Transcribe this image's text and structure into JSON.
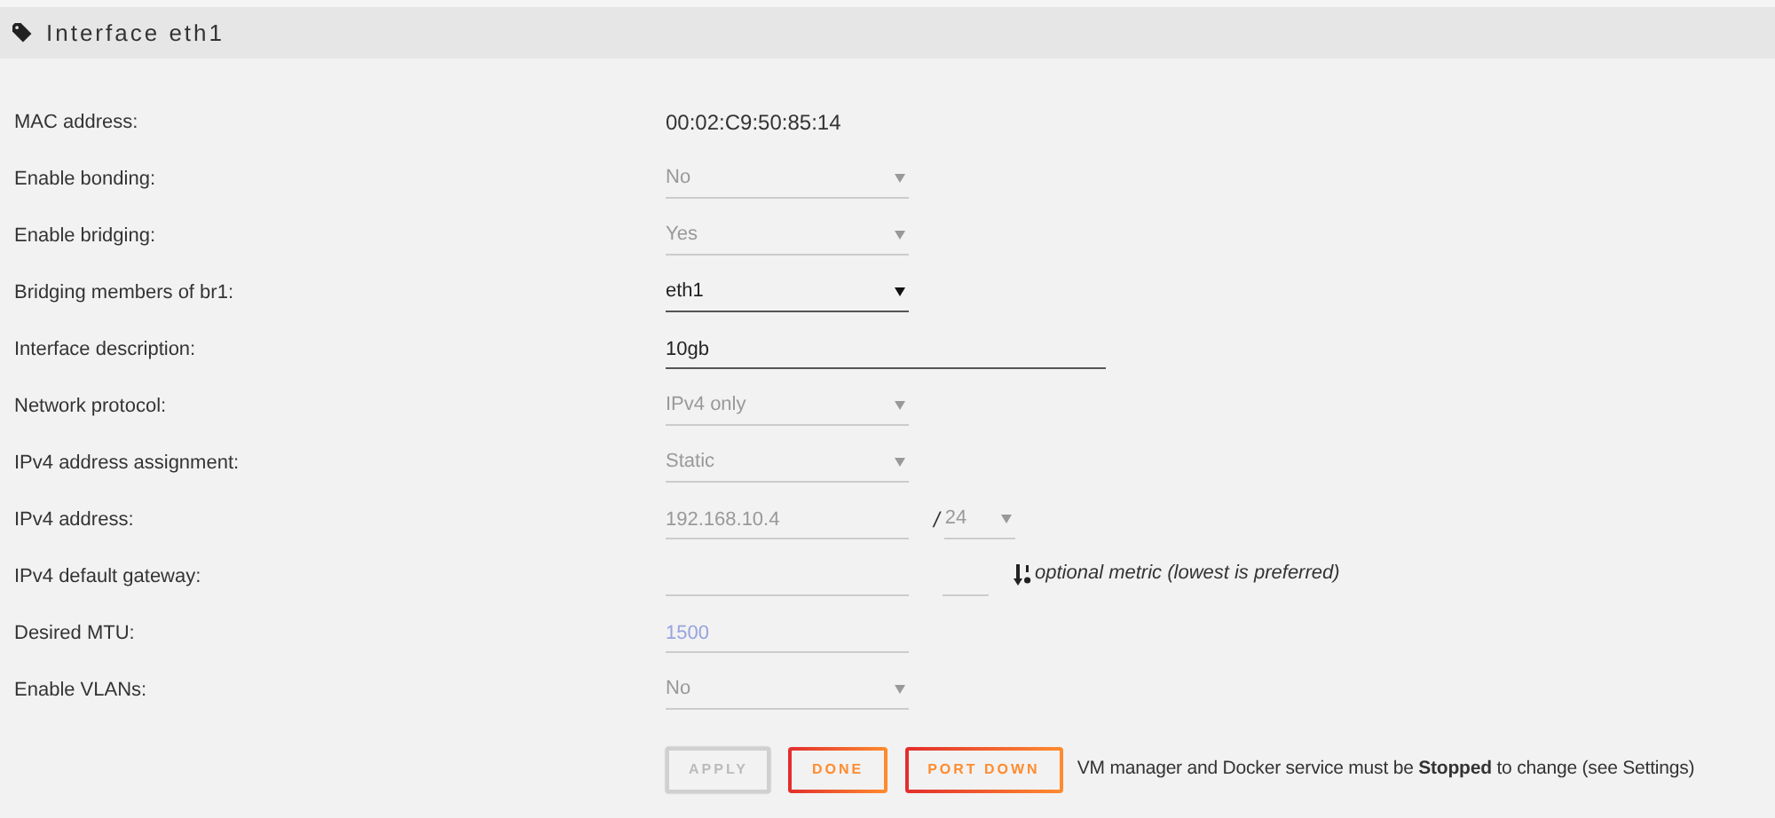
{
  "panel": {
    "title": "Interface eth1"
  },
  "rows": [
    {
      "kind": "text",
      "label": "MAC address:",
      "value": "00:02:C9:50:85:14"
    },
    {
      "kind": "select",
      "label": "Enable bonding:",
      "value": "No",
      "disabled": true
    },
    {
      "kind": "select",
      "label": "Enable bridging:",
      "value": "Yes",
      "disabled": true
    },
    {
      "kind": "select",
      "label": "Bridging members of br1:",
      "value": "eth1",
      "disabled": false
    },
    {
      "kind": "input",
      "label": "Interface description:",
      "value": "10gb",
      "wide": true,
      "disabled": false
    },
    {
      "kind": "select",
      "label": "Network protocol:",
      "value": "IPv4 only",
      "disabled": true
    },
    {
      "kind": "select",
      "label": "IPv4 address assignment:",
      "value": "Static",
      "disabled": true
    },
    {
      "kind": "ip",
      "label": "IPv4 address:",
      "value": "192.168.10.4",
      "separator": "/",
      "prefix": "24",
      "disabled": true
    },
    {
      "kind": "gateway",
      "label": "IPv4 default gateway:",
      "note": "optional metric (lowest is preferred)",
      "disabled": true
    },
    {
      "kind": "input",
      "label": "Desired MTU:",
      "placeholder": "1500",
      "wide": false,
      "disabled": true
    },
    {
      "kind": "select",
      "label": "Enable VLANs:",
      "value": "No",
      "disabled": true
    }
  ],
  "buttons": [
    {
      "label": "APPLY",
      "disabled": true
    },
    {
      "label": "DONE",
      "disabled": false
    },
    {
      "label": "PORT DOWN",
      "disabled": false
    }
  ],
  "note": "VM manager and Docker service must be **Stopped** to change (see Settings)"
}
